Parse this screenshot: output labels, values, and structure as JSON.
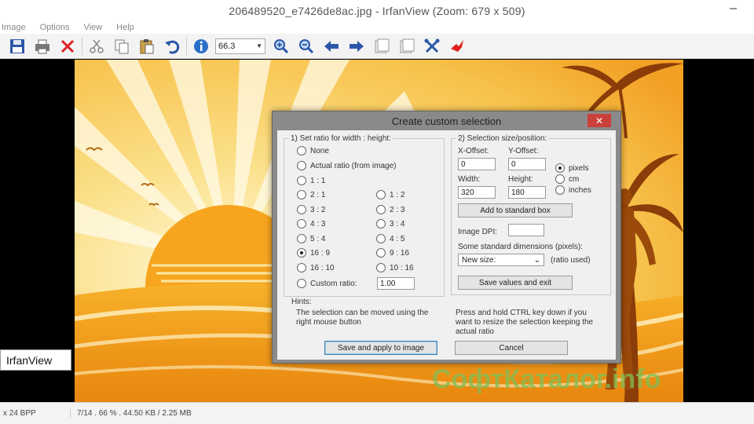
{
  "window": {
    "title": "206489520_e7426de8ac.jpg - IrfanView (Zoom: 679 x 509)",
    "minimize_glyph": "–"
  },
  "menu": [
    "Image",
    "Options",
    "View",
    "Help"
  ],
  "toolbar": {
    "zoom_value": "66.3",
    "icons": [
      "save-icon",
      "print-icon",
      "delete-icon",
      "cut-icon",
      "copy-icon",
      "paste-icon",
      "undo-icon",
      "info-icon",
      "zoom-in-icon",
      "zoom-out-icon",
      "back-icon",
      "forward-icon",
      "page-prev-icon",
      "page-next-icon",
      "settings-icon",
      "irfan-logo-icon"
    ]
  },
  "side_label": "IrfanView",
  "status": {
    "left": "x 24 BPP",
    "right": "7/14 . 66 % . 44.50 KB / 2.25 MB"
  },
  "watermark": "СофтКаталог.info",
  "dialog": {
    "title": "Create custom selection",
    "close_glyph": "✕",
    "ratio_group": {
      "title": "1) Set ratio for width : height:",
      "options_full": [
        {
          "label": "None",
          "selected": false
        },
        {
          "label": "Actual ratio (from image)",
          "selected": false
        },
        {
          "label": "1 : 1",
          "selected": false
        }
      ],
      "options_grid": [
        {
          "left": "2 : 1",
          "right": "1 : 2"
        },
        {
          "left": "3 : 2",
          "right": "2 : 3"
        },
        {
          "left": "4 : 3",
          "right": "3 : 4"
        },
        {
          "left": "5 : 4",
          "right": "4 : 5"
        },
        {
          "left": "16 : 9",
          "right": "9 : 16"
        },
        {
          "left": "16 : 10",
          "right": "10 : 16"
        }
      ],
      "selected_label": "16 : 9",
      "custom_label": "Custom ratio:",
      "custom_value": "1.00"
    },
    "size_group": {
      "title": "2) Selection size/position:",
      "x_label": "X-Offset:",
      "y_label": "Y-Offset:",
      "x_value": "0",
      "y_value": "0",
      "width_label": "Width:",
      "height_label": "Height:",
      "width_value": "320",
      "height_value": "180",
      "units": [
        {
          "label": "pixels",
          "selected": true
        },
        {
          "label": "cm",
          "selected": false
        },
        {
          "label": "inches",
          "selected": false
        }
      ],
      "add_button": "Add to standard box",
      "dpi_label": "Image DPI:",
      "dpi_value": "",
      "standard_label": "Some standard dimensions (pixels):",
      "standard_select": "New size:",
      "ratio_used": "(ratio used)",
      "save_values_button": "Save values and exit"
    },
    "hints": {
      "title": "Hints:",
      "left": "The selection can be moved using the right mouse button",
      "right": "Press and hold CTRL key down if you want to resize the selection keeping the actual ratio"
    },
    "apply_button": "Save and apply to image",
    "cancel_button": "Cancel"
  }
}
